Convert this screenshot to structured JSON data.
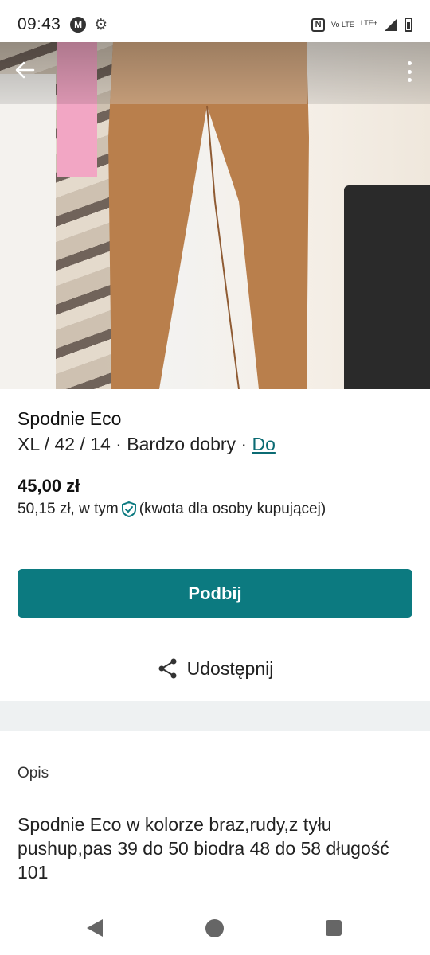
{
  "status_bar": {
    "time": "09:43",
    "left_icons": [
      "motorola-icon",
      "gear-icon"
    ],
    "right_icons": [
      "nfc-icon",
      "volte-icon",
      "lte-icon",
      "signal-icon",
      "battery-icon"
    ],
    "volte_label": "Vo LTE",
    "lte_label": "LTE+"
  },
  "header": {
    "back_icon": "arrow-left-icon",
    "menu_icon": "more-vert-icon"
  },
  "listing": {
    "title": "Spodnie Eco",
    "meta_text": "XL / 42 / 14 · Bardzo dobry · ",
    "meta_link": "Do",
    "price": "45,00 zł",
    "price_total_prefix": "50,15 zł, w tym",
    "price_total_suffix": "(kwota dla osoby kupującej)"
  },
  "actions": {
    "bump_label": "Podbij",
    "share_label": "Udostępnij"
  },
  "description": {
    "label": "Opis",
    "text": "Spodnie Eco w kolorze braz,rudy,z tyłu pushup,pas 39 do 50 biodra 48 do 58 długość 101"
  },
  "colors": {
    "accent": "#0c7a80",
    "link": "#0b6b73"
  }
}
